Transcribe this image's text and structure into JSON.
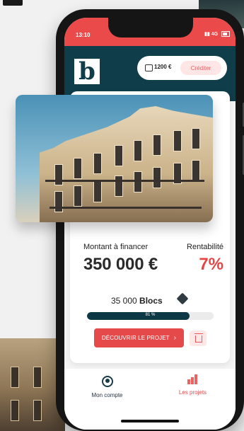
{
  "status_bar": {
    "time": "13:10",
    "network": "4G"
  },
  "header": {
    "logo_letter": "b",
    "balance": "1200 €",
    "credit_button": "Créditer"
  },
  "property": {
    "financing_label": "Montant à financer",
    "yield_label": "Rentabilité",
    "amount": "350 000 €",
    "yield": "7%",
    "blocks_count": "35 000",
    "blocks_label": "Blocs",
    "progress_text": "81 %",
    "progress_value": 0.81,
    "cta_label": "DÉCOUVRIR LE PROJET"
  },
  "bottom_nav": {
    "account_label": "Mon compte",
    "projects_label": "Les projets"
  },
  "colors": {
    "brand_dark": "#103d4a",
    "accent_red": "#e6494a"
  }
}
